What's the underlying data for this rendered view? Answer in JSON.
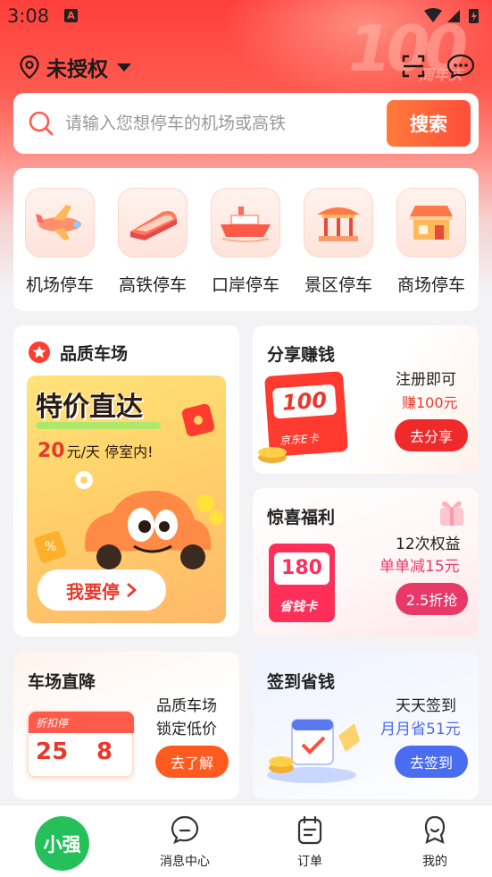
{
  "status": {
    "time": "3:08",
    "notif": "A"
  },
  "location": {
    "text": "未授权"
  },
  "search": {
    "placeholder": "请输入您想停车的机场或高铁",
    "button": "搜索"
  },
  "categories": [
    {
      "label": "机场停车",
      "icon": "airplane-icon"
    },
    {
      "label": "高铁停车",
      "icon": "train-icon"
    },
    {
      "label": "口岸停车",
      "icon": "ship-icon"
    },
    {
      "label": "景区停车",
      "icon": "pavilion-icon"
    },
    {
      "label": "商场停车",
      "icon": "mall-icon"
    }
  ],
  "quality": {
    "title": "品质车场",
    "promo_title": "特价直达",
    "promo_price": "20",
    "promo_unit": "元/天 停室内!",
    "cta": "我要停"
  },
  "share": {
    "title": "分享赚钱",
    "line1": "注册即可",
    "line2": "赚100元",
    "card_value": "100",
    "card_label": "京东E卡",
    "button": "去分享"
  },
  "surprise": {
    "title": "惊喜福利",
    "line1": "12次权益",
    "line2": "单单减15元",
    "card_value": "180",
    "card_label": "省钱卡",
    "button": "2.5折抢"
  },
  "discount": {
    "title": "车场直降",
    "line1": "品质车场",
    "line2": "锁定低价",
    "ticket_title": "折扣停",
    "ticket_days": "25",
    "ticket_rate": "8",
    "button": "去了解"
  },
  "checkin": {
    "title": "签到省钱",
    "line1": "天天签到",
    "line2": "月月省51元",
    "button": "去签到"
  },
  "nav": {
    "home": "小强",
    "messages": "消息中心",
    "orders": "订单",
    "mine": "我的"
  },
  "colors": {
    "brand_red": "#ff4e3a",
    "pink": "#e83a6e",
    "blue": "#4a6cf0",
    "green": "#26c05a"
  }
}
